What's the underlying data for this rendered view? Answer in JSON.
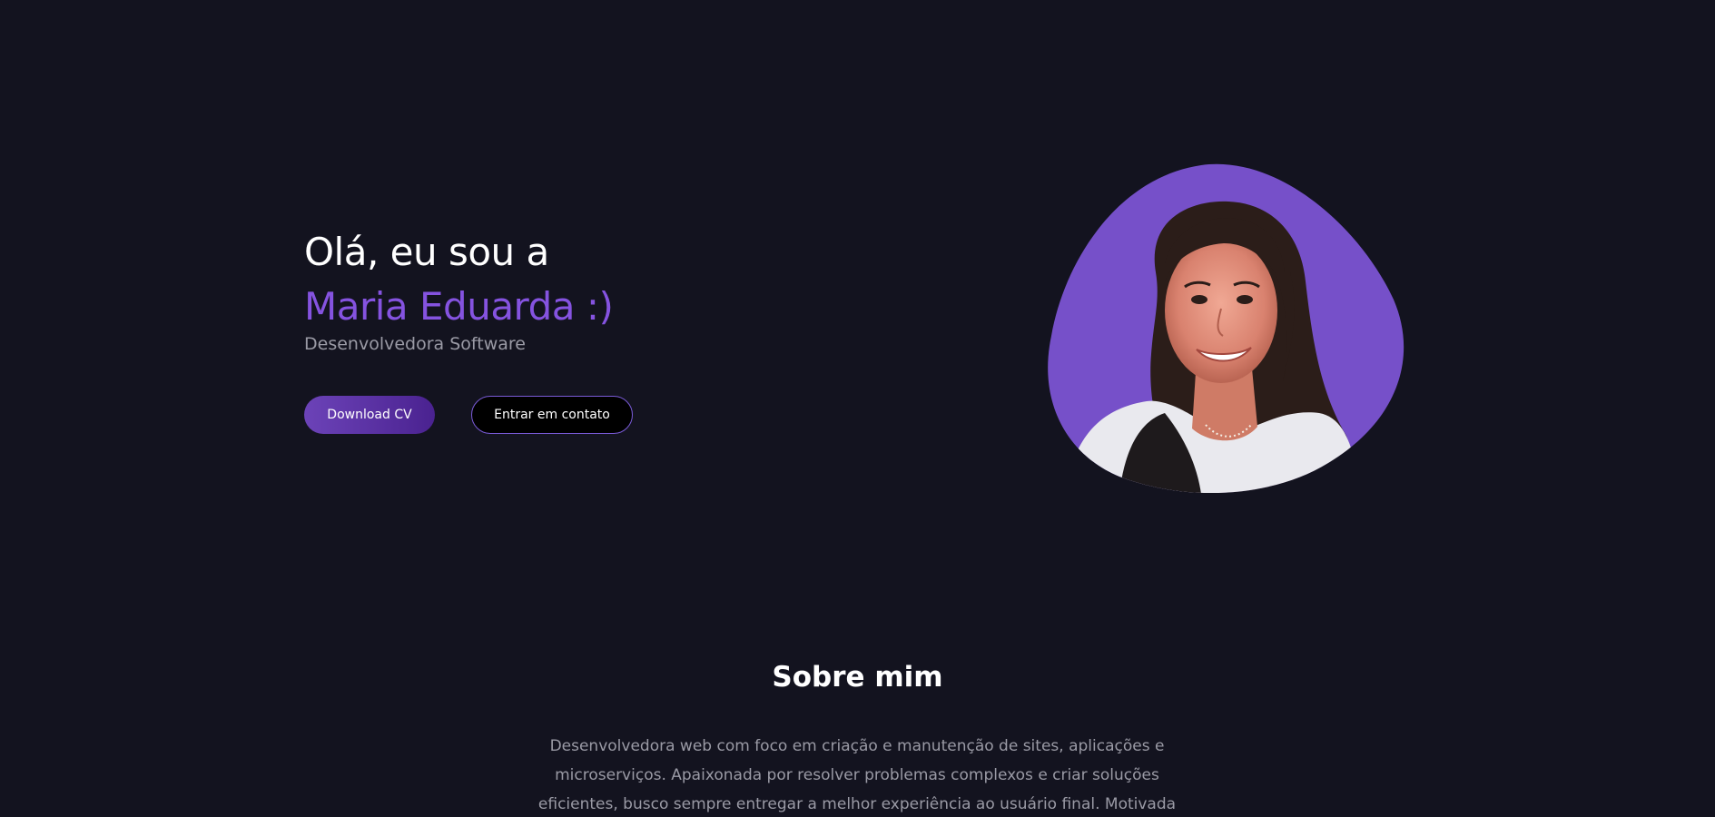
{
  "hero": {
    "greeting": "Olá, eu sou a",
    "name": "Maria Eduarda :)",
    "role": "Desenvolvedora Software",
    "download_label": "Download CV",
    "contact_label": "Entrar em contato",
    "photo_alt": "Maria Eduarda"
  },
  "about": {
    "title": "Sobre mim",
    "text": "Desenvolvedora web com foco em criação e manutenção de sites, aplicações e microserviços. Apaixonada por resolver problemas complexos e criar soluções eficientes, busco sempre entregar a melhor experiência ao usuário final. Motivada por"
  },
  "colors": {
    "background": "#13131f",
    "accent": "#8553e0",
    "blob": "#7650c9",
    "muted_text": "#9a9aa5"
  }
}
